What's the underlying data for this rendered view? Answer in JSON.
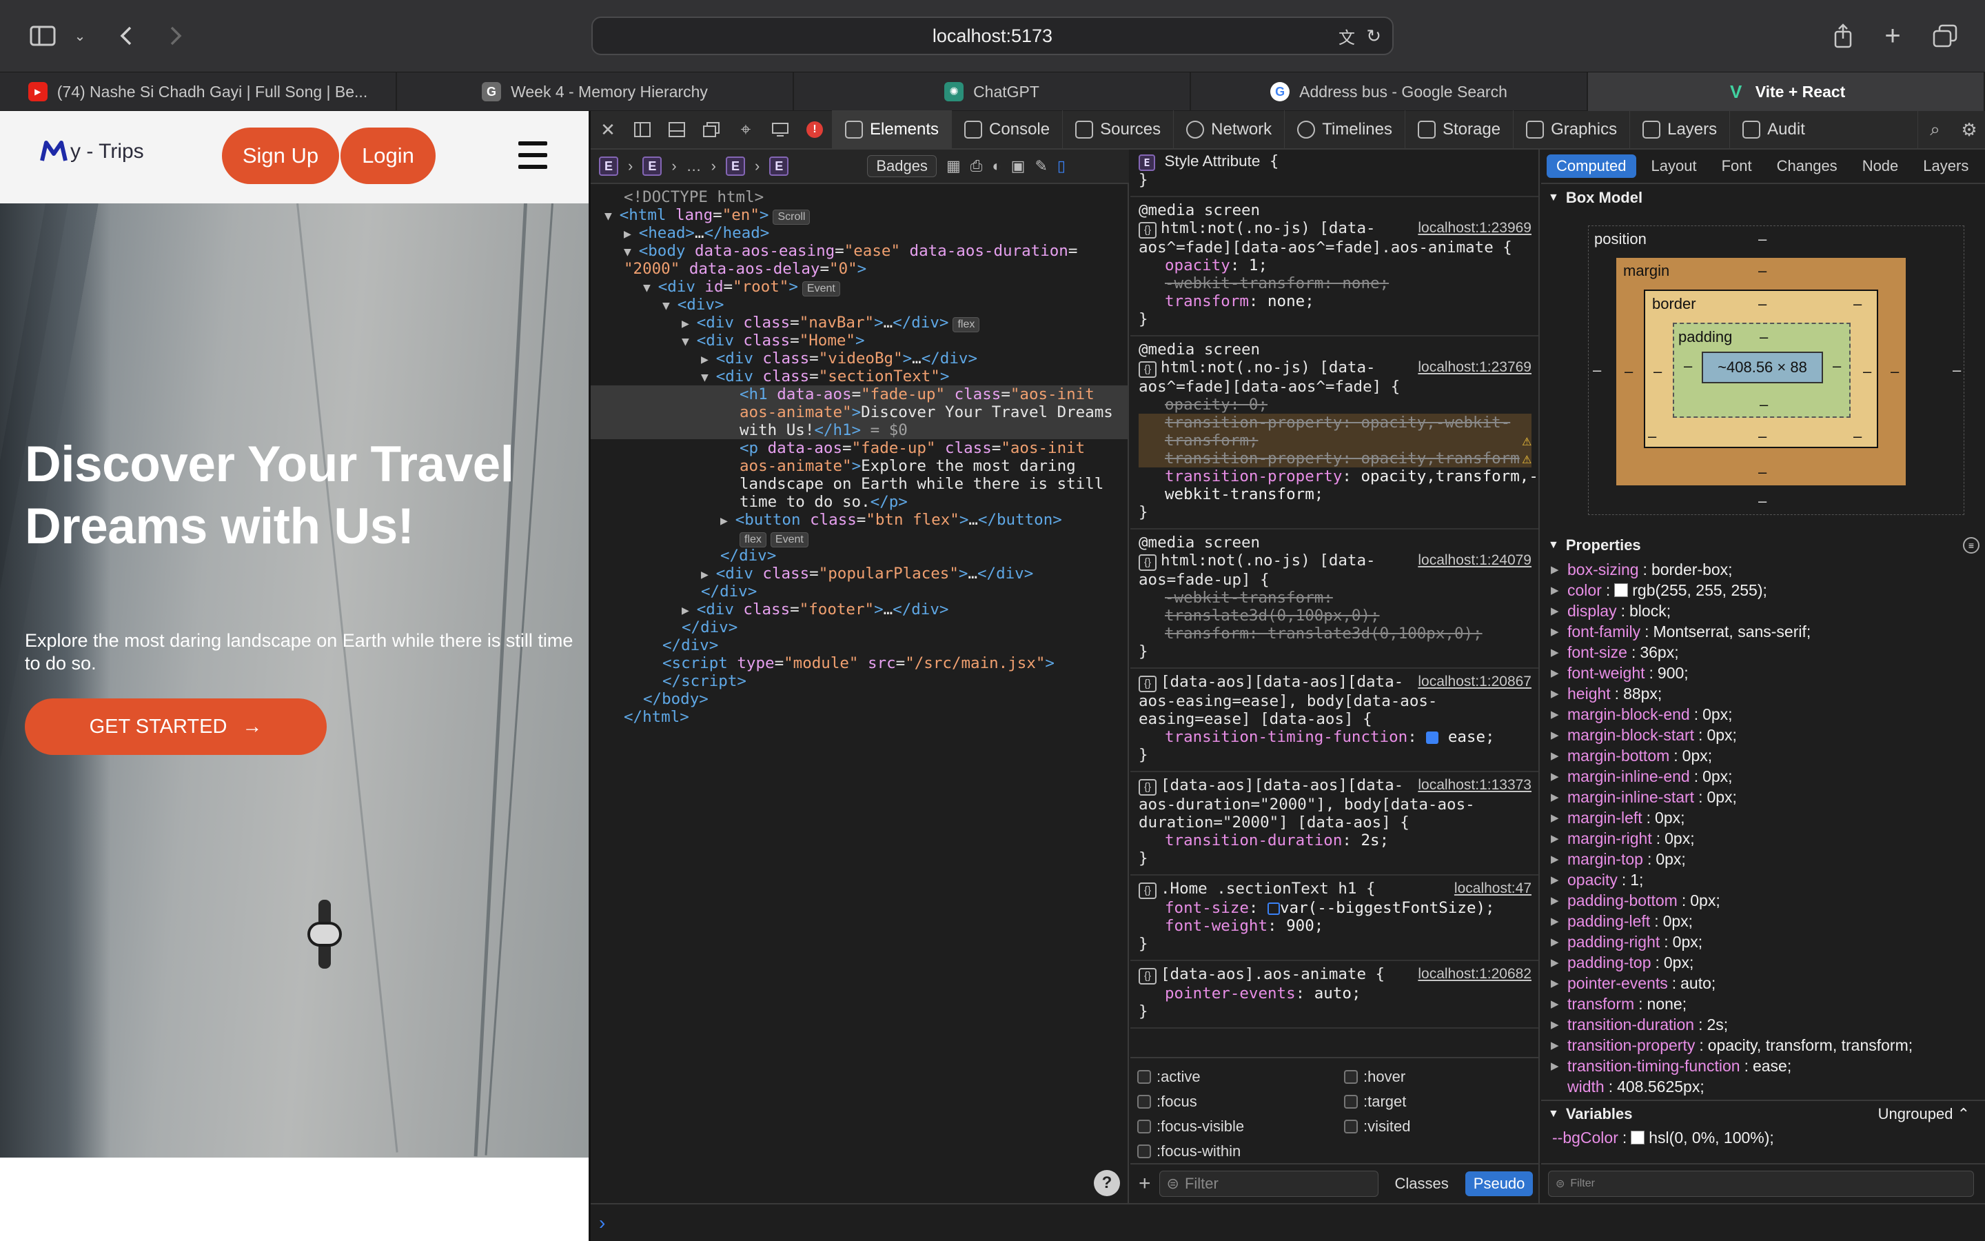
{
  "browser": {
    "url": "localhost:5173",
    "tabs": [
      {
        "title": "(74) Nashe Si Chadh Gayi | Full Song | Be...",
        "icon": "youtube-icon",
        "active": false
      },
      {
        "title": "Week 4 - Memory Hierarchy",
        "icon": "g-icon",
        "active": false
      },
      {
        "title": "ChatGPT",
        "icon": "chatgpt-icon",
        "active": false
      },
      {
        "title": "Address bus - Google Search",
        "icon": "google-icon",
        "active": false
      },
      {
        "title": "Vite + React",
        "icon": "vite-icon",
        "active": true
      }
    ]
  },
  "site": {
    "logo_text": "y - Trips",
    "signup": "Sign Up",
    "login": "Login",
    "hero_title": "Discover Your Travel Dreams with Us!",
    "hero_subtitle": "Explore the most daring landscape on Earth while there is still time to do so.",
    "cta": "GET STARTED",
    "cta_arrow": "→"
  },
  "devtools": {
    "tabs": [
      "Elements",
      "Console",
      "Sources",
      "Network",
      "Timelines",
      "Storage",
      "Graphics",
      "Layers",
      "Audit"
    ],
    "active_tab": "Elements",
    "crumb_ellipsis": "…",
    "badges_label": "Badges",
    "dom_selected_suffix": "= $0",
    "styles": {
      "style_attribute": "Style Attribute",
      "media_screen": "@media screen",
      "pseudo": [
        ":active",
        ":hover",
        ":focus",
        ":target",
        ":focus-visible",
        ":visited",
        ":focus-within"
      ],
      "filter_placeholder": "Filter",
      "classes_label": "Classes",
      "pseudo_label": "Pseudo"
    },
    "computed": {
      "tabs": [
        "Computed",
        "Layout",
        "Font",
        "Changes",
        "Node",
        "Layers"
      ],
      "box_model_title": "Box Model",
      "position_label": "position",
      "margin_label": "margin",
      "border_label": "border",
      "padding_label": "padding",
      "content_size": "~408.56 × 88",
      "dash": "–",
      "properties_title": "Properties",
      "properties": [
        {
          "name": "box-sizing",
          "value": "border-box;"
        },
        {
          "name": "color",
          "value": "rgb(255, 255, 255);",
          "swatch": "#ffffff"
        },
        {
          "name": "display",
          "value": "block;"
        },
        {
          "name": "font-family",
          "value": "Montserrat, sans-serif;"
        },
        {
          "name": "font-size",
          "value": "36px;"
        },
        {
          "name": "font-weight",
          "value": "900;"
        },
        {
          "name": "height",
          "value": "88px;"
        },
        {
          "name": "margin-block-end",
          "value": "0px;"
        },
        {
          "name": "margin-block-start",
          "value": "0px;"
        },
        {
          "name": "margin-bottom",
          "value": "0px;"
        },
        {
          "name": "margin-inline-end",
          "value": "0px;"
        },
        {
          "name": "margin-inline-start",
          "value": "0px;"
        },
        {
          "name": "margin-left",
          "value": "0px;"
        },
        {
          "name": "margin-right",
          "value": "0px;"
        },
        {
          "name": "margin-top",
          "value": "0px;"
        },
        {
          "name": "opacity",
          "value": "1;"
        },
        {
          "name": "padding-bottom",
          "value": "0px;"
        },
        {
          "name": "padding-left",
          "value": "0px;"
        },
        {
          "name": "padding-right",
          "value": "0px;"
        },
        {
          "name": "padding-top",
          "value": "0px;"
        },
        {
          "name": "pointer-events",
          "value": "auto;"
        },
        {
          "name": "transform",
          "value": "none;"
        },
        {
          "name": "transition-duration",
          "value": "2s;"
        },
        {
          "name": "transition-property",
          "value": "opacity, transform, transform;"
        },
        {
          "name": "transition-timing-function",
          "value": "ease;"
        },
        {
          "name": "width",
          "value": "408.5625px;",
          "no_arrow": true
        }
      ],
      "variables_title": "Variables",
      "ungrouped_label": "Ungrouped",
      "variable": {
        "name": "--bgColor",
        "value": "hsl(0, 0%, 100%);"
      },
      "filter_placeholder": "Filter"
    }
  },
  "colors": {
    "accent": "#e0522b",
    "devtools_blue": "#2f74d0"
  }
}
